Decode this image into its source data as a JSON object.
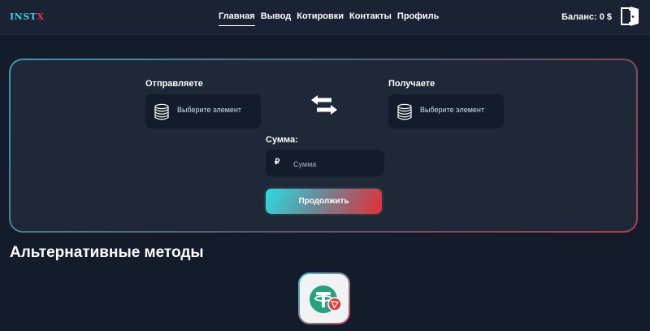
{
  "brand": {
    "logo_part1": "INST",
    "logo_part2": "X"
  },
  "nav": {
    "items": [
      {
        "label": "Главная"
      },
      {
        "label": "Вывод"
      },
      {
        "label": "Котировки"
      },
      {
        "label": "Контакты"
      },
      {
        "label": "Профиль"
      }
    ],
    "active_index": 0
  },
  "header": {
    "balance": "Баланс: 0 $",
    "exit_icon": "door-exit-icon"
  },
  "exchange": {
    "send_label": "Отправляете",
    "receive_label": "Получаете",
    "send_select": "Выберите элемент",
    "receive_select": "Выберите элемент",
    "coin_icon": "coins-stack-icon",
    "swap_icon": "swap-arrows-icon",
    "amount_label": "Сумма:",
    "currency_symbol": "₽",
    "amount_placeholder": "Сумма",
    "amount_value": "",
    "continue_label": "Продолжить"
  },
  "alternatives": {
    "title": "Альтернативные методы",
    "methods": [
      {
        "icon": "usdt-trc20-icon"
      }
    ]
  },
  "colors": {
    "background": "#141b2b",
    "card": "#1e2838",
    "accent_cyan": "#2ddbe0",
    "accent_red": "#e52d36"
  }
}
